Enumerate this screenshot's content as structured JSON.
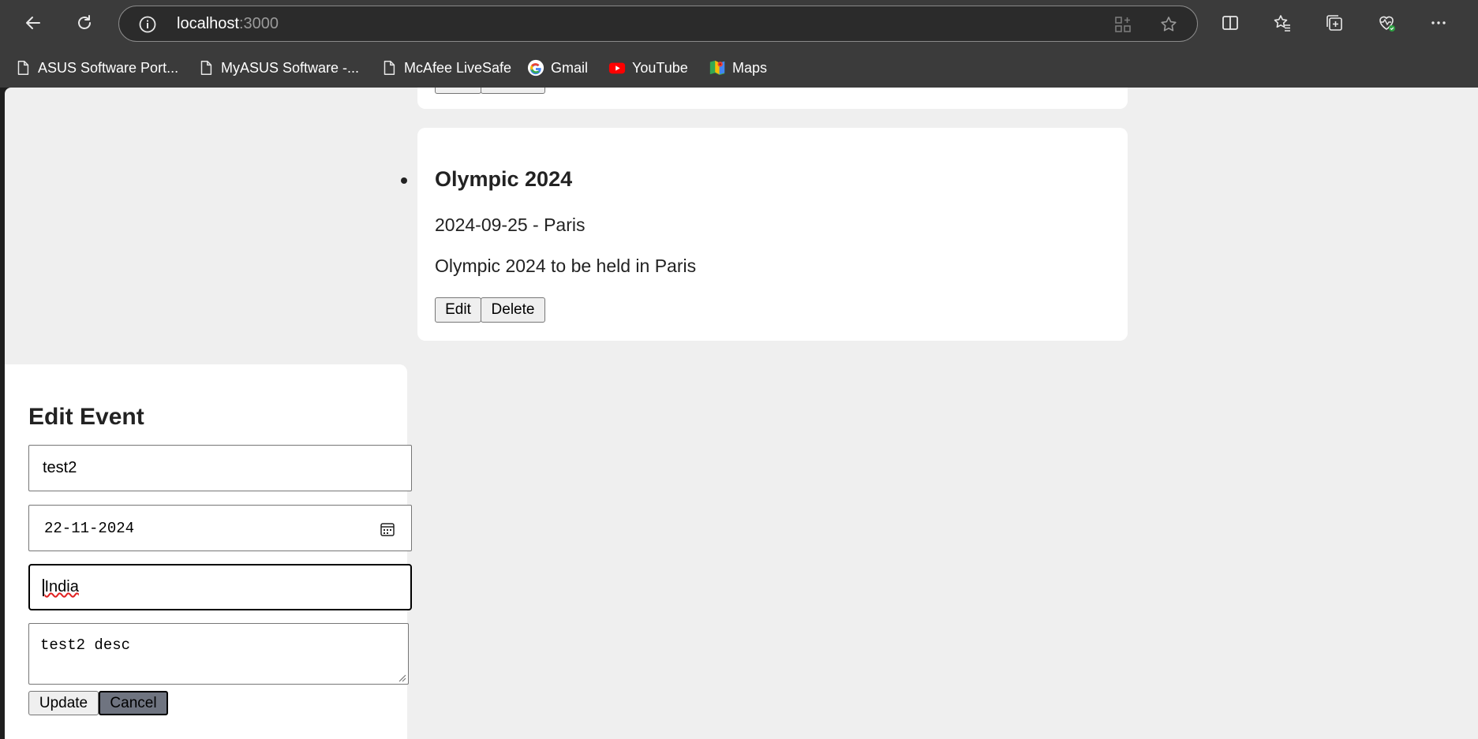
{
  "browser": {
    "url_host": "localhost",
    "url_port": ":3000",
    "bookmarks": [
      {
        "label": "ASUS Software Port...",
        "icon": "page-icon"
      },
      {
        "label": "MyASUS Software -...",
        "icon": "page-icon"
      },
      {
        "label": "McAfee LiveSafe",
        "icon": "page-icon"
      },
      {
        "label": "Gmail",
        "icon": "google-icon"
      },
      {
        "label": "YouTube",
        "icon": "youtube-icon"
      },
      {
        "label": "Maps",
        "icon": "maps-icon"
      }
    ]
  },
  "events": {
    "partial_card": {
      "edit_label": "Edit",
      "delete_label": "Delete"
    },
    "card": {
      "title": "Olympic 2024",
      "meta": "2024-09-25 - Paris",
      "description": "Olympic 2024 to be held in Paris",
      "edit_label": "Edit",
      "delete_label": "Delete"
    }
  },
  "edit_form": {
    "heading": "Edit Event",
    "title_value": "test2",
    "date_value": "22-11-2024",
    "location_value": "India",
    "description_value": "test2 desc",
    "update_label": "Update",
    "cancel_label": "Cancel"
  },
  "colors": {
    "chrome_bg": "#3b3b3b",
    "page_bg": "#efefef",
    "card_bg": "#ffffff",
    "cancel_bg": "#6f7480"
  }
}
